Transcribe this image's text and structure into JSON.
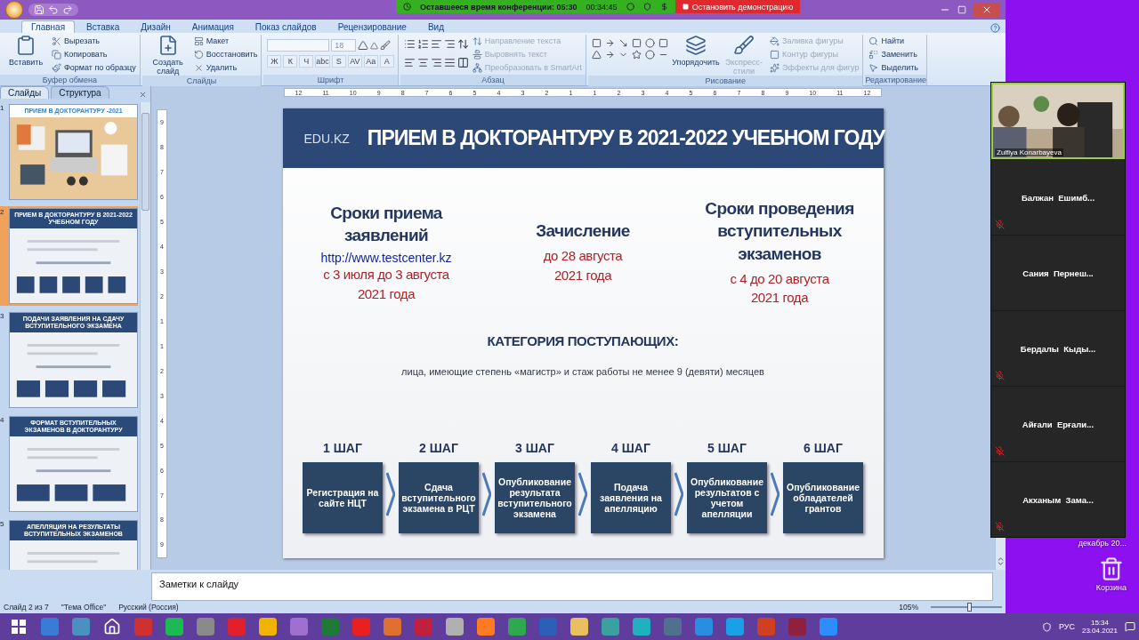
{
  "conference_bar": {
    "remaining": "Оставшееся время конференции: 05:30",
    "elapsed": "00:34:45",
    "stop_button": "Остановить демонстрацию"
  },
  "ribbon": {
    "tabs": [
      {
        "label": "Главная",
        "selected": true
      },
      {
        "label": "Вставка",
        "selected": false
      },
      {
        "label": "Дизайн",
        "selected": false
      },
      {
        "label": "Анимация",
        "selected": false
      },
      {
        "label": "Показ слайдов",
        "selected": false
      },
      {
        "label": "Рецензирование",
        "selected": false
      },
      {
        "label": "Вид",
        "selected": false
      }
    ],
    "groups": [
      {
        "label": "Буфер обмена",
        "columns": [
          {
            "kind": "large",
            "items": [
              {
                "kind": "paste",
                "label": "Вставить",
                "disabled": false
              }
            ]
          },
          {
            "kind": "stack",
            "items": [
              {
                "kind": "cut",
                "label": "Вырезать",
                "disabled": false
              },
              {
                "kind": "copy",
                "label": "Копировать",
                "disabled": false
              },
              {
                "kind": "brush",
                "label": "Формат по образцу",
                "disabled": false
              }
            ]
          }
        ]
      },
      {
        "label": "Слайды",
        "columns": [
          {
            "kind": "large",
            "items": [
              {
                "kind": "newslide",
                "label": "Создать слайд",
                "disabled": false
              }
            ]
          },
          {
            "kind": "stack",
            "items": [
              {
                "kind": "layout",
                "label": "Макет",
                "disabled": false
              },
              {
                "kind": "reset",
                "label": "Восстановить",
                "disabled": false
              },
              {
                "kind": "delete",
                "label": "Удалить",
                "disabled": false
              }
            ]
          }
        ]
      },
      {
        "label": "Шрифт",
        "columns": [
          {
            "kind": "font",
            "size": "18",
            "buttons": [
              "Ж",
              "К",
              "Ч",
              "abc",
              "S",
              "AV",
              "Aa",
              "A"
            ]
          }
        ]
      },
      {
        "label": "Абзац",
        "columns": [
          {
            "kind": "para"
          },
          {
            "kind": "stack",
            "items": [
              {
                "kind": "textdir",
                "label": "Направление текста",
                "disabled": true
              },
              {
                "kind": "align",
                "label": "Выровнять текст",
                "disabled": true
              },
              {
                "kind": "smartart",
                "label": "Преобразовать в SmartArt",
                "disabled": true
              }
            ]
          }
        ]
      },
      {
        "label": "Рисование",
        "columns": [
          {
            "kind": "shapes"
          },
          {
            "kind": "large",
            "items": [
              {
                "kind": "arrange",
                "label": "Упорядочить",
                "disabled": false
              }
            ]
          },
          {
            "kind": "large",
            "items": [
              {
                "kind": "styles",
                "label": "Экспресс-стили",
                "disabled": true
              }
            ]
          },
          {
            "kind": "stack",
            "items": [
              {
                "kind": "fill",
                "label": "Заливка фигуры",
                "disabled": true
              },
              {
                "kind": "outline",
                "label": "Контур фигуры",
                "disabled": true
              },
              {
                "kind": "effects",
                "label": "Эффекты для фигур",
                "disabled": true
              }
            ]
          }
        ]
      },
      {
        "label": "Редактирование",
        "columns": [
          {
            "kind": "stack",
            "items": [
              {
                "kind": "find",
                "label": "Найти",
                "disabled": false
              },
              {
                "kind": "replace",
                "label": "Заменить",
                "disabled": false
              },
              {
                "kind": "select",
                "label": "Выделить",
                "disabled": false
              }
            ]
          }
        ]
      }
    ]
  },
  "slides_pane": {
    "tabs": [
      {
        "label": "Слайды",
        "selected": true
      },
      {
        "label": "Структура",
        "selected": false
      }
    ],
    "thumbnails": [
      {
        "number": "1",
        "title": "ПРИЕМ В ДОКТОРАНТУРУ  -2021",
        "selected": false
      },
      {
        "number": "2",
        "kind": "slide",
        "title": "ПРИЕМ В ДОКТОРАНТУРУ В 2021-2022 УЧЕБНОМ ГОДУ",
        "selected": true
      },
      {
        "number": "3",
        "kind": "slide",
        "title": "ПОДАЧИ ЗАЯВЛЕНИЯ НА СДАЧУ ВСТУПИТЕЛЬНОГО ЭКЗАМЕНА",
        "selected": false
      },
      {
        "number": "4",
        "kind": "slide",
        "title": "ФОРМАТ ВСТУПИТЕЛЬНЫХ ЭКЗАМЕНОВ В ДОКТОРАНТУРУ",
        "selected": false
      },
      {
        "number": "5",
        "kind": "slide",
        "title": "АПЕЛЛЯЦИЯ НА РЕЗУЛЬТАТЫ ВСТУПИТЕЛЬНЫХ ЭКЗАМЕНОВ",
        "selected": false
      }
    ]
  },
  "ruler": {
    "horizontal": [
      "12",
      "11",
      "10",
      "9",
      "8",
      "7",
      "6",
      "5",
      "4",
      "3",
      "2",
      "1",
      "1",
      "2",
      "3",
      "4",
      "5",
      "6",
      "7",
      "8",
      "9",
      "10",
      "11",
      "12"
    ],
    "vertical": [
      "9",
      "8",
      "7",
      "6",
      "5",
      "4",
      "3",
      "2",
      "1",
      "1",
      "2",
      "3",
      "4",
      "5",
      "6",
      "7",
      "8",
      "9"
    ]
  },
  "slide": {
    "logo": "EDU.KZ",
    "title": "ПРИЕМ В ДОКТОРАНТУРУ В 2021-2022 УЧЕБНОМ ГОДУ",
    "columns": [
      {
        "heading": "Сроки приема заявлений",
        "link": "http://www.testcenter.kz",
        "dates": [
          "с 3 июля до 3 августа",
          "2021 года"
        ]
      },
      {
        "heading": "Зачисление",
        "dates": [
          "до 28 августа",
          "2021 года"
        ]
      },
      {
        "heading": "Сроки проведения вступительных экзаменов",
        "dates": [
          "с 4 до 20 августа",
          "2021 года"
        ]
      }
    ],
    "category_title": "КАТЕГОРИЯ ПОСТУПАЮЩИХ:",
    "category_text": "лица, имеющие степень «магистр» и стаж работы не менее 9 (девяти) месяцев",
    "steps": [
      {
        "label": "1 ШАГ",
        "text": "Регистрация на сайте НЦТ"
      },
      {
        "label": "2 ШАГ",
        "text": "Сдача вступительного экзамена в РЦТ"
      },
      {
        "label": "3 ШАГ",
        "text": "Опубликование результата вступительного экзамена"
      },
      {
        "label": "4 ШАГ",
        "text": "Подача заявления на апелляцию"
      },
      {
        "label": "5 ШАГ",
        "text": "Опубликование результатов с учетом апелляции"
      },
      {
        "label": "6 ШАГ",
        "text": "Опубликование обладателей грантов"
      }
    ]
  },
  "notes": {
    "placeholder": "Заметки к слайду"
  },
  "status_bar": {
    "slide": "Слайд 2 из 7",
    "theme": "\"Тема Office\"",
    "language": "Русский (Россия)",
    "zoom": "105%",
    "zoom_slider": {
      "level": 0.55
    }
  },
  "participants": [
    {
      "kind": "video",
      "name": "Zulfiya Konarbayeva",
      "muted": false
    },
    {
      "kind": "tile",
      "name": "Балжан  Ешимб...",
      "muted": true
    },
    {
      "kind": "tile",
      "name": "Сания  Пернеш...",
      "muted": false
    },
    {
      "kind": "tile",
      "name": "Бердалы  Кыды...",
      "muted": true
    },
    {
      "kind": "tile",
      "name": "Айғали  Ерғали...",
      "muted": true
    },
    {
      "kind": "tile",
      "name": "Акханым  Зама...",
      "muted": true
    }
  ],
  "desktop": {
    "label": "декабрь 20...",
    "recycle_bin": "Корзина"
  },
  "taskbar": {
    "apps": [
      {
        "kind": "start",
        "color": "#ffffff"
      },
      {
        "kind": "app",
        "color": "#3a7bd5"
      },
      {
        "kind": "app",
        "color": "#4a90c0"
      },
      {
        "kind": "home",
        "color": "#ffffff"
      },
      {
        "kind": "app",
        "color": "#d03030"
      },
      {
        "kind": "app",
        "color": "#1db954"
      },
      {
        "kind": "app",
        "color": "#8a8a8a"
      },
      {
        "kind": "app",
        "color": "#e0202a"
      },
      {
        "kind": "app",
        "color": "#f0b400"
      },
      {
        "kind": "app",
        "color": "#a070d0"
      },
      {
        "kind": "app",
        "color": "#1f7a3a"
      },
      {
        "kind": "app",
        "color": "#e82020"
      },
      {
        "kind": "app",
        "color": "#e07030"
      },
      {
        "kind": "app",
        "color": "#c02040"
      },
      {
        "kind": "app",
        "color": "#b0b0b0"
      },
      {
        "kind": "app",
        "color": "#ff7a20"
      },
      {
        "kind": "app",
        "color": "#2fa84f"
      },
      {
        "kind": "app",
        "color": "#2b5fb8"
      },
      {
        "kind": "app",
        "color": "#e8c060"
      },
      {
        "kind": "app",
        "color": "#3aa0a0"
      },
      {
        "kind": "app",
        "color": "#20b0c0"
      },
      {
        "kind": "app",
        "color": "#507090"
      },
      {
        "kind": "app",
        "color": "#2a8ee0"
      },
      {
        "kind": "app",
        "color": "#1aa0e8"
      },
      {
        "kind": "app",
        "color": "#d04020"
      },
      {
        "kind": "app",
        "color": "#902040"
      },
      {
        "kind": "app",
        "color": "#2d8cff"
      }
    ],
    "language": "РУС",
    "time": "15:34",
    "date": "23.04.2021"
  }
}
